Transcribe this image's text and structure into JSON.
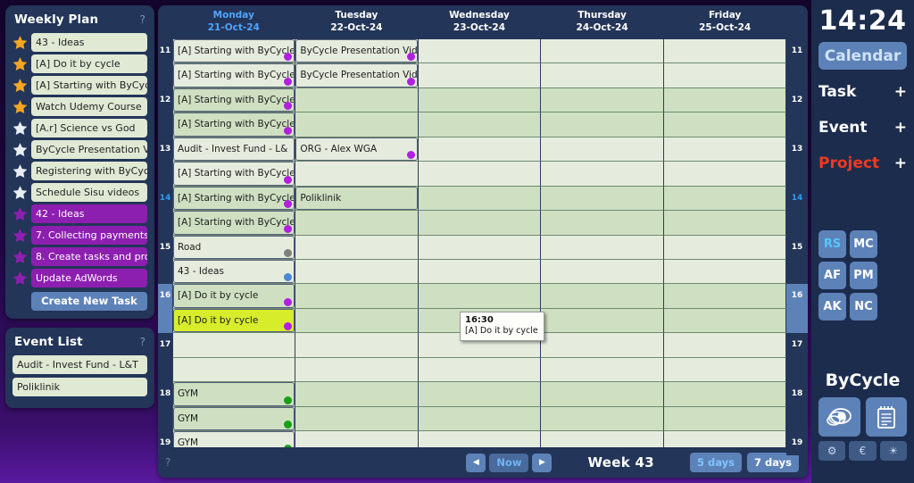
{
  "weekly_plan": {
    "title": "Weekly Plan",
    "help": "?",
    "tasks": [
      {
        "label": "43 - Ideas",
        "star": "filled",
        "style": "green"
      },
      {
        "label": "[A] Do it by cycle",
        "star": "filled",
        "style": "green"
      },
      {
        "label": "[A] Starting with ByCyc",
        "star": "filled",
        "style": "green"
      },
      {
        "label": "Watch Udemy Course",
        "star": "filled",
        "style": "green"
      },
      {
        "label": "[A.r] Science vs God",
        "star": "empty",
        "style": "green"
      },
      {
        "label": "ByCycle Presentation V",
        "star": "empty",
        "style": "green"
      },
      {
        "label": "Registering with ByCyc",
        "star": "empty",
        "style": "green"
      },
      {
        "label": "Schedule Sisu videos",
        "star": "empty",
        "style": "green"
      },
      {
        "label": "42 - Ideas",
        "star": "purple",
        "style": "purple"
      },
      {
        "label": "7. Collecting payments",
        "star": "purple",
        "style": "purple"
      },
      {
        "label": "8. Create tasks and pro",
        "star": "purple",
        "style": "purple"
      },
      {
        "label": "Update AdWords",
        "star": "purple",
        "style": "purple"
      }
    ],
    "create_button": "Create New Task"
  },
  "event_list": {
    "title": "Event List",
    "help": "?",
    "events": [
      {
        "label": "Audit - Invest Fund - L&T"
      },
      {
        "label": "Poliklinik"
      }
    ]
  },
  "calendar": {
    "days": [
      {
        "name": "Monday",
        "date": "21-Oct-24",
        "today": true
      },
      {
        "name": "Tuesday",
        "date": "22-Oct-24",
        "today": false
      },
      {
        "name": "Wednesday",
        "date": "23-Oct-24",
        "today": false
      },
      {
        "name": "Thursday",
        "date": "24-Oct-24",
        "today": false
      },
      {
        "name": "Friday",
        "date": "25-Oct-24",
        "today": false
      }
    ],
    "rows": [
      {
        "hour": "11",
        "show_hour": true,
        "alt": false,
        "current": false,
        "selected": false,
        "cells": [
          {
            "label": "[A] Starting with ByCycle",
            "dot": "purple"
          },
          {
            "label": "ByCycle Presentation Vide",
            "dot": "purple"
          },
          {
            "label": "",
            "dot": ""
          },
          {
            "label": "",
            "dot": ""
          },
          {
            "label": "",
            "dot": ""
          }
        ]
      },
      {
        "hour": "",
        "show_hour": false,
        "alt": false,
        "current": false,
        "selected": false,
        "cells": [
          {
            "label": "[A] Starting with ByCycle",
            "dot": "purple"
          },
          {
            "label": "ByCycle Presentation Vide",
            "dot": "purple"
          },
          {
            "label": "",
            "dot": ""
          },
          {
            "label": "",
            "dot": ""
          },
          {
            "label": "",
            "dot": ""
          }
        ]
      },
      {
        "hour": "12",
        "show_hour": true,
        "alt": true,
        "current": false,
        "selected": false,
        "cells": [
          {
            "label": "[A] Starting with ByCycle",
            "dot": "purple"
          },
          {
            "label": "",
            "dot": ""
          },
          {
            "label": "",
            "dot": ""
          },
          {
            "label": "",
            "dot": ""
          },
          {
            "label": "",
            "dot": ""
          }
        ]
      },
      {
        "hour": "",
        "show_hour": false,
        "alt": true,
        "current": false,
        "selected": false,
        "cells": [
          {
            "label": "[A] Starting with ByCycle",
            "dot": "purple"
          },
          {
            "label": "",
            "dot": ""
          },
          {
            "label": "",
            "dot": ""
          },
          {
            "label": "",
            "dot": ""
          },
          {
            "label": "",
            "dot": ""
          }
        ]
      },
      {
        "hour": "13",
        "show_hour": true,
        "alt": false,
        "current": false,
        "selected": false,
        "cells": [
          {
            "label": "Audit - Invest Fund - L&",
            "dot": ""
          },
          {
            "label": "ORG - Alex WGA",
            "dot": "purple"
          },
          {
            "label": "",
            "dot": ""
          },
          {
            "label": "",
            "dot": ""
          },
          {
            "label": "",
            "dot": ""
          }
        ]
      },
      {
        "hour": "",
        "show_hour": false,
        "alt": false,
        "current": false,
        "selected": false,
        "cells": [
          {
            "label": "[A] Starting with ByCycle",
            "dot": "purple"
          },
          {
            "label": "",
            "dot": ""
          },
          {
            "label": "",
            "dot": ""
          },
          {
            "label": "",
            "dot": ""
          },
          {
            "label": "",
            "dot": ""
          }
        ]
      },
      {
        "hour": "14",
        "show_hour": true,
        "alt": true,
        "current": true,
        "selected": false,
        "cells": [
          {
            "label": "[A] Starting with ByCycle",
            "dot": "purple"
          },
          {
            "label": "Poliklinik",
            "dot": ""
          },
          {
            "label": "",
            "dot": ""
          },
          {
            "label": "",
            "dot": ""
          },
          {
            "label": "",
            "dot": ""
          }
        ]
      },
      {
        "hour": "",
        "show_hour": false,
        "alt": true,
        "current": false,
        "selected": false,
        "cells": [
          {
            "label": "[A] Starting with ByCycle",
            "dot": "purple"
          },
          {
            "label": "",
            "dot": ""
          },
          {
            "label": "",
            "dot": ""
          },
          {
            "label": "",
            "dot": ""
          },
          {
            "label": "",
            "dot": ""
          }
        ]
      },
      {
        "hour": "15",
        "show_hour": true,
        "alt": false,
        "current": false,
        "selected": false,
        "cells": [
          {
            "label": "Road",
            "dot": "gray"
          },
          {
            "label": "",
            "dot": ""
          },
          {
            "label": "",
            "dot": ""
          },
          {
            "label": "",
            "dot": ""
          },
          {
            "label": "",
            "dot": ""
          }
        ]
      },
      {
        "hour": "",
        "show_hour": false,
        "alt": false,
        "current": false,
        "selected": false,
        "cells": [
          {
            "label": "43 - Ideas",
            "dot": "blue"
          },
          {
            "label": "",
            "dot": ""
          },
          {
            "label": "",
            "dot": ""
          },
          {
            "label": "",
            "dot": ""
          },
          {
            "label": "",
            "dot": ""
          }
        ]
      },
      {
        "hour": "16",
        "show_hour": true,
        "alt": true,
        "current": false,
        "selected": true,
        "cells": [
          {
            "label": "[A] Do it by cycle",
            "dot": "purple"
          },
          {
            "label": "",
            "dot": ""
          },
          {
            "label": "",
            "dot": ""
          },
          {
            "label": "",
            "dot": ""
          },
          {
            "label": "",
            "dot": ""
          }
        ]
      },
      {
        "hour": "",
        "show_hour": false,
        "alt": true,
        "current": false,
        "selected": true,
        "cells": [
          {
            "label": "[A] Do it by cycle",
            "dot": "purple",
            "highlight": true
          },
          {
            "label": "",
            "dot": ""
          },
          {
            "label": "",
            "dot": ""
          },
          {
            "label": "",
            "dot": ""
          },
          {
            "label": "",
            "dot": ""
          }
        ]
      },
      {
        "hour": "17",
        "show_hour": true,
        "alt": false,
        "current": false,
        "selected": false,
        "cells": [
          {
            "label": "",
            "dot": ""
          },
          {
            "label": "",
            "dot": ""
          },
          {
            "label": "",
            "dot": ""
          },
          {
            "label": "",
            "dot": ""
          },
          {
            "label": "",
            "dot": ""
          }
        ]
      },
      {
        "hour": "",
        "show_hour": false,
        "alt": false,
        "current": false,
        "selected": false,
        "cells": [
          {
            "label": "",
            "dot": ""
          },
          {
            "label": "",
            "dot": ""
          },
          {
            "label": "",
            "dot": ""
          },
          {
            "label": "",
            "dot": ""
          },
          {
            "label": "",
            "dot": ""
          }
        ]
      },
      {
        "hour": "18",
        "show_hour": true,
        "alt": true,
        "current": false,
        "selected": false,
        "cells": [
          {
            "label": "GYM",
            "dot": "green"
          },
          {
            "label": "",
            "dot": ""
          },
          {
            "label": "",
            "dot": ""
          },
          {
            "label": "",
            "dot": ""
          },
          {
            "label": "",
            "dot": ""
          }
        ]
      },
      {
        "hour": "",
        "show_hour": false,
        "alt": true,
        "current": false,
        "selected": false,
        "cells": [
          {
            "label": "GYM",
            "dot": "green"
          },
          {
            "label": "",
            "dot": ""
          },
          {
            "label": "",
            "dot": ""
          },
          {
            "label": "",
            "dot": ""
          },
          {
            "label": "",
            "dot": ""
          }
        ]
      },
      {
        "hour": "19",
        "show_hour": true,
        "alt": false,
        "current": false,
        "selected": false,
        "cells": [
          {
            "label": "GYM",
            "dot": "green"
          },
          {
            "label": "",
            "dot": ""
          },
          {
            "label": "",
            "dot": ""
          },
          {
            "label": "",
            "dot": ""
          },
          {
            "label": "",
            "dot": ""
          }
        ]
      }
    ],
    "tooltip": {
      "time": "16:30",
      "text": "[A] Do it by cycle"
    },
    "footer": {
      "help": "?",
      "prev": "◀",
      "now": "Now",
      "next": "▶",
      "week": "Week 43",
      "five_days": "5 days",
      "seven_days": "7 days"
    }
  },
  "right_panel": {
    "clock": "14:24",
    "nav": [
      {
        "label": "Calendar",
        "plus": "",
        "active": true
      },
      {
        "label": "Task",
        "plus": "+",
        "active": false
      },
      {
        "label": "Event",
        "plus": "+",
        "active": false
      },
      {
        "label": "Project",
        "plus": "+",
        "active": false
      }
    ],
    "badges": [
      {
        "label": "RS",
        "active": true
      },
      {
        "label": "MC",
        "active": false
      },
      {
        "label": "AF",
        "active": false
      },
      {
        "label": "PM",
        "active": false
      },
      {
        "label": "AK",
        "active": false
      },
      {
        "label": "NC",
        "active": false
      }
    ],
    "brand": "ByCycle",
    "big_icons": [
      "eye-disc-icon",
      "notepad-icon"
    ],
    "small_icons": [
      {
        "name": "gear-icon",
        "glyph": "⚙"
      },
      {
        "name": "euro-icon",
        "glyph": "€"
      },
      {
        "name": "bulb-icon",
        "glyph": "☀"
      }
    ]
  },
  "colors": {
    "panel_bg": "#233558",
    "accent_blue": "#5d82b8",
    "task_purple": "#8d1fb0",
    "project_red": "#f03a20",
    "highlight_yellow": "#d7ec2b"
  }
}
